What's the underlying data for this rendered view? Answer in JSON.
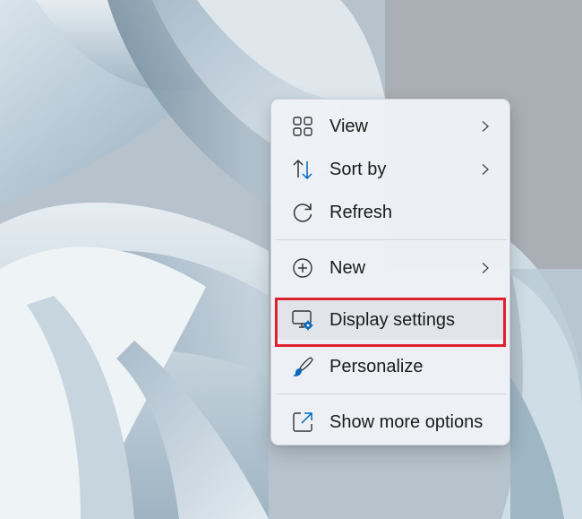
{
  "context_menu": {
    "items": [
      {
        "label": "View",
        "icon": "grid-icon",
        "has_submenu": true
      },
      {
        "label": "Sort by",
        "icon": "sort-arrows-icon",
        "has_submenu": true
      },
      {
        "label": "Refresh",
        "icon": "refresh-icon",
        "has_submenu": false
      },
      {
        "label": "New",
        "icon": "plus-circle-icon",
        "has_submenu": true
      },
      {
        "label": "Display settings",
        "icon": "display-settings-icon",
        "has_submenu": false,
        "highlighted": true
      },
      {
        "label": "Personalize",
        "icon": "brush-icon",
        "has_submenu": false
      },
      {
        "label": "Show more options",
        "icon": "open-external-icon",
        "has_submenu": false
      }
    ]
  },
  "colors": {
    "highlight_border": "#e0202f",
    "accent_blue": "#0067c0",
    "menu_background": "#eef2f6"
  }
}
